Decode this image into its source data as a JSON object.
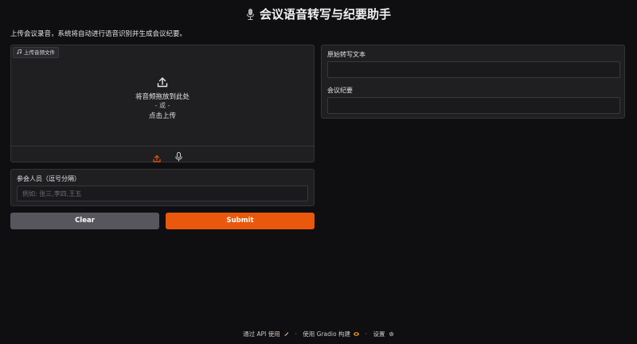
{
  "app": {
    "title": "会议语音转写与纪要助手",
    "description": "上传会议录音，系统将自动进行语音识别并生成会议纪要。"
  },
  "upload": {
    "label": "上传音频文件",
    "drop_text": "将音频拖放到此处",
    "or_text": "- 或 -",
    "click_text": "点击上传",
    "toolbar_icons": [
      "upload-icon",
      "microphone-icon"
    ]
  },
  "participants": {
    "label": "参会人员（逗号分隔）",
    "placeholder": "例如: 张三,李四,王五",
    "value": ""
  },
  "buttons": {
    "clear": "Clear",
    "submit": "Submit"
  },
  "outputs": {
    "transcript_label": "原始转写文本",
    "minutes_label": "会议纪要"
  },
  "footer": {
    "api": "通过 API 使用",
    "built": "使用 Gradio 构建",
    "settings": "设置"
  },
  "colors": {
    "background": "#0f0f11",
    "panel": "#1f1f22",
    "accent": "#ea580c",
    "secondary_button": "#56565c"
  }
}
